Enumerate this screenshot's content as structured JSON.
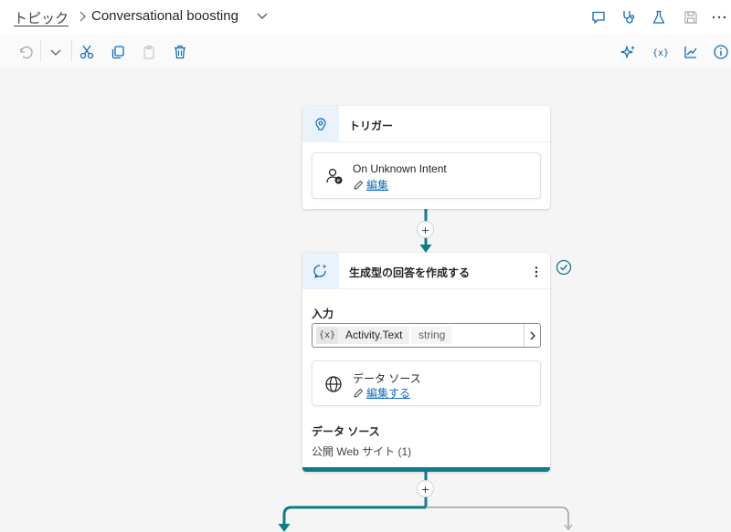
{
  "header": {
    "breadcrumb_parent": "トピック",
    "topic_title": "Conversational boosting",
    "icons": [
      "chat-icon",
      "stethoscope-icon",
      "beaker-icon",
      "save-icon",
      "more-icon"
    ]
  },
  "toolbar": {
    "icons": [
      "undo-icon",
      "chevron-down-icon",
      "cut-icon",
      "copy-icon",
      "paste-icon",
      "delete-icon",
      "sparkle-icon",
      "variable-icon",
      "analytics-icon",
      "info-icon"
    ]
  },
  "trigger_node": {
    "title": "トリガー",
    "intent_title": "On Unknown Intent",
    "edit_label": "編集"
  },
  "generative_node": {
    "title": "生成型の回答を作成する",
    "input_label": "入力",
    "variable_badge": "{x}",
    "variable_name": "Activity.Text",
    "variable_type": "string",
    "datasource_card_title": "データ ソース",
    "datasource_edit_label": "編集する",
    "datasource_section_label": "データ ソース",
    "datasource_value": "公開 Web サイト (1)"
  },
  "colors": {
    "accent": "#117b8a",
    "link": "#0f6cbd",
    "icon_bg": "#eaf3fb"
  }
}
